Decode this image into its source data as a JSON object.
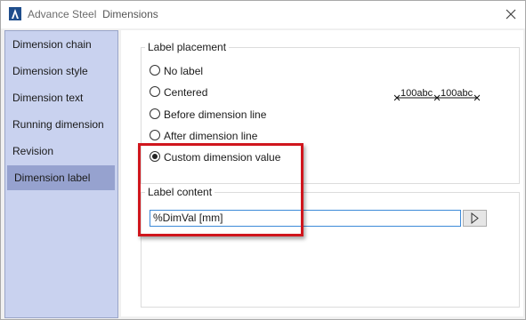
{
  "window": {
    "app_name": "Advance Steel",
    "dialog_title": "Dimensions"
  },
  "sidebar": {
    "items": [
      {
        "label": "Dimension chain",
        "active": false
      },
      {
        "label": "Dimension style",
        "active": false
      },
      {
        "label": "Dimension text",
        "active": false
      },
      {
        "label": "Running dimension",
        "active": false
      },
      {
        "label": "Revision",
        "active": false
      },
      {
        "label": "Dimension label",
        "active": true
      }
    ]
  },
  "label_placement": {
    "group_title": "Label placement",
    "options": [
      {
        "label": "No label",
        "checked": false
      },
      {
        "label": "Centered",
        "checked": false
      },
      {
        "label": "Before dimension line",
        "checked": false
      },
      {
        "label": "After dimension line",
        "checked": false
      },
      {
        "label": "Custom dimension value",
        "checked": true
      }
    ],
    "preview_text_1": "100abc",
    "preview_text_2": "100abc"
  },
  "label_content": {
    "group_title": "Label content",
    "value": "%DimVal [mm]"
  },
  "colors": {
    "sidebar_bg": "#c9d2ef",
    "sidebar_active": "#96a2cf",
    "highlight": "#d0161d",
    "input_border": "#3c8ad8"
  },
  "icons": {
    "app_logo": "advance-steel-logo-icon",
    "close": "close-icon",
    "play": "play-icon"
  }
}
